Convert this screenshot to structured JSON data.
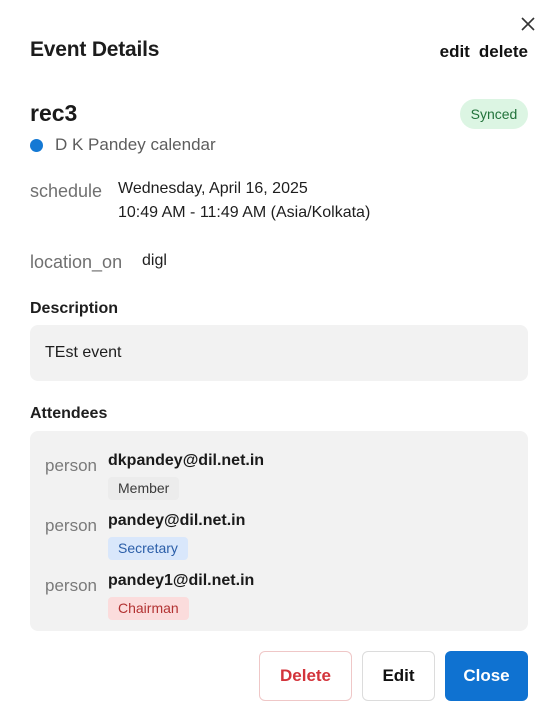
{
  "dialog": {
    "title": "Event Details",
    "header_actions": {
      "edit": "edit",
      "delete": "delete"
    }
  },
  "event": {
    "title": "rec3",
    "status_badge": "Synced",
    "calendar_name": "D K Pandey calendar",
    "calendar_color": "#1479d4",
    "schedule_icon": "schedule",
    "date": "Wednesday, April 16, 2025",
    "time": "10:49 AM - 11:49 AM (Asia/Kolkata)",
    "location_icon": "location_on",
    "location": "digl"
  },
  "description": {
    "heading": "Description",
    "text": "TEst event"
  },
  "attendees": {
    "heading": "Attendees",
    "items": [
      {
        "icon": "person",
        "email": "dkpandey@dil.net.in",
        "role": "Member"
      },
      {
        "icon": "person",
        "email": "pandey@dil.net.in",
        "role": "Secretary"
      },
      {
        "icon": "person",
        "email": "pandey1@dil.net.in",
        "role": "Chairman"
      }
    ]
  },
  "footer": {
    "delete_label": "Delete",
    "edit_label": "Edit",
    "close_label": "Close"
  },
  "colors": {
    "primary": "#0f72d1",
    "danger": "#d3343b",
    "synced_bg": "#dcf5e3"
  }
}
